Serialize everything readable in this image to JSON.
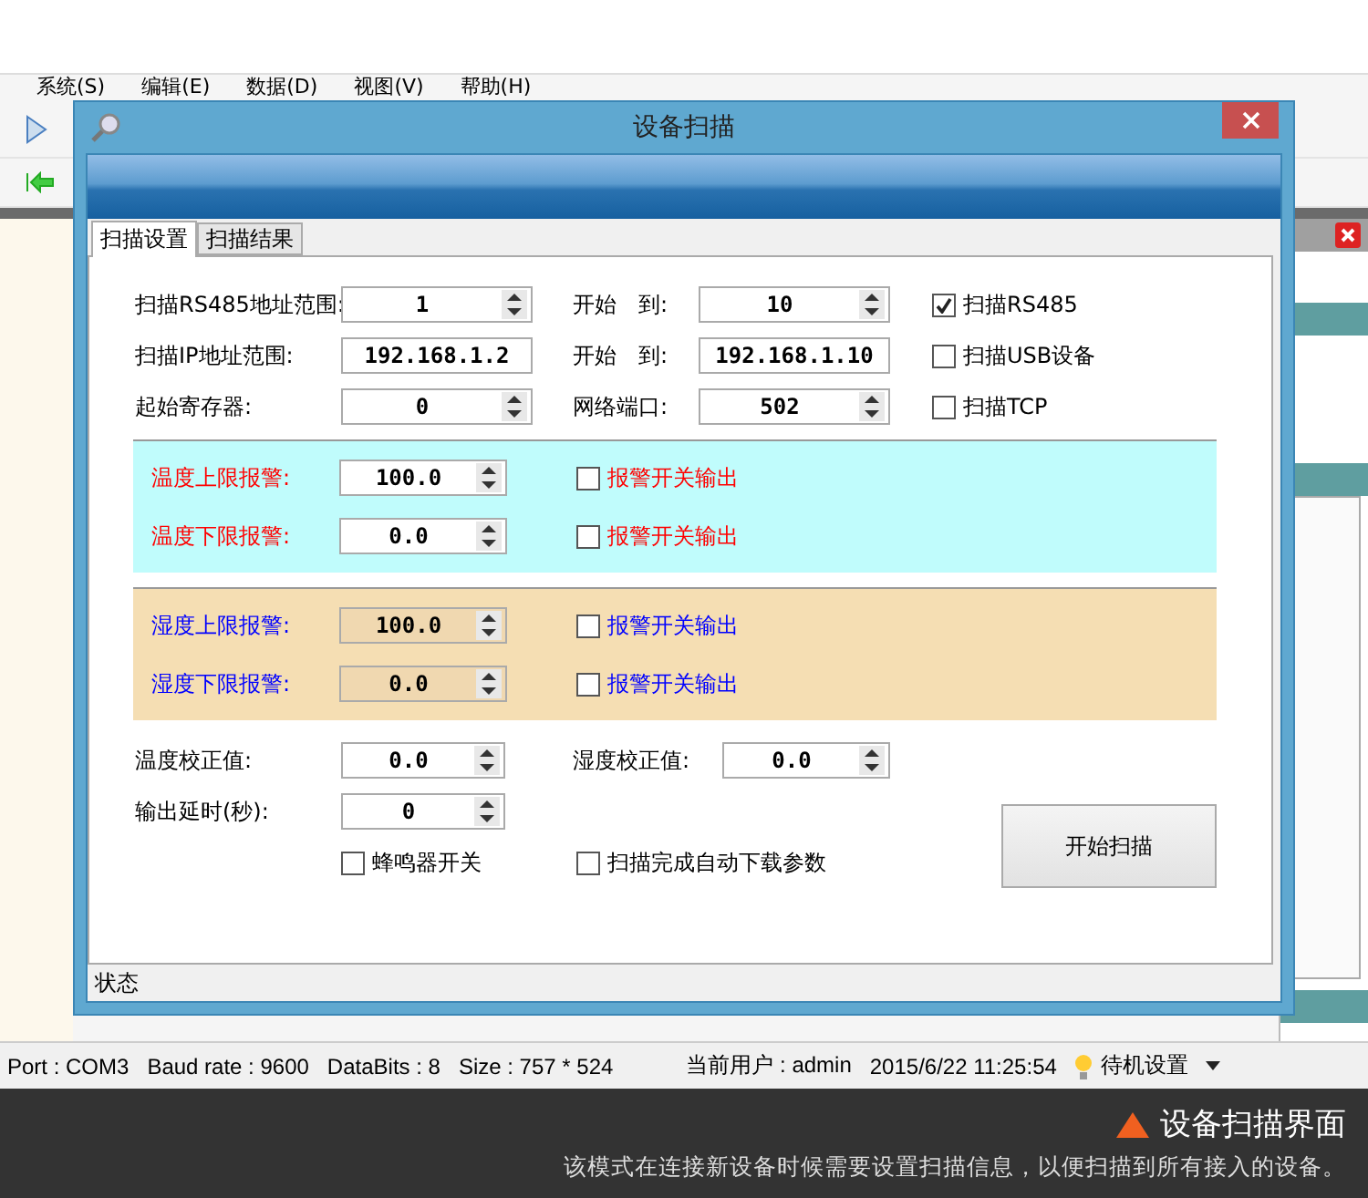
{
  "app": {
    "menu": [
      "系统(S)",
      "编辑(E)",
      "数据(D)",
      "视图(V)",
      "帮助(H)"
    ]
  },
  "dialog": {
    "title": "设备扫描",
    "tabs": [
      {
        "label": "扫描设置",
        "selected": true
      },
      {
        "label": "扫描结果",
        "selected": false
      }
    ],
    "scan_rows": [
      {
        "label": "扫描RS485地址范围:",
        "from": {
          "kind": "spin",
          "value": "1"
        },
        "to_label": "开始　到:",
        "to": {
          "kind": "spin",
          "value": "10"
        },
        "option": {
          "label": "扫描RS485",
          "checked": true
        }
      },
      {
        "label": "扫描IP地址范围:",
        "from": {
          "kind": "text",
          "value": "192.168.1.2"
        },
        "to_label": "开始　到:",
        "to": {
          "kind": "text",
          "value": "192.168.1.10"
        },
        "option": {
          "label": "扫描USB设备",
          "checked": false
        }
      },
      {
        "label": "起始寄存器:",
        "from": {
          "kind": "spin",
          "value": "0"
        },
        "to_label": "网络端口:",
        "to": {
          "kind": "spin",
          "value": "502"
        },
        "option": {
          "label": "扫描TCP",
          "checked": false
        }
      }
    ],
    "alarm_panels": [
      {
        "kind": "temperature",
        "rows": [
          {
            "label": "温度上限报警:",
            "value": "100.0",
            "option": {
              "label": "报警开关输出",
              "checked": false
            }
          },
          {
            "label": "温度下限报警:",
            "value": "0.0",
            "option": {
              "label": "报警开关输出",
              "checked": false
            }
          }
        ]
      },
      {
        "kind": "humidity",
        "rows": [
          {
            "label": "湿度上限报警:",
            "value": "100.0",
            "option": {
              "label": "报警开关输出",
              "checked": false
            }
          },
          {
            "label": "湿度下限报警:",
            "value": "0.0",
            "option": {
              "label": "报警开关输出",
              "checked": false
            }
          }
        ]
      }
    ],
    "calibration": [
      {
        "label": "温度校正值:",
        "value": "0.0"
      },
      {
        "label": "湿度校正值:",
        "value": "0.0"
      }
    ],
    "delay": {
      "label": "输出延时(秒):",
      "value": "0"
    },
    "options": [
      {
        "label": "蜂鸣器开关",
        "checked": false
      },
      {
        "label": "扫描完成自动下载参数",
        "checked": false
      }
    ],
    "start_button": "开始扫描",
    "status": "状态"
  },
  "status_bar": {
    "items": [
      "Port : COM3",
      "Baud rate  : 9600",
      "DataBits : 8",
      "Size : 757 * 524",
      "当前用户 : admin",
      "2015/6/22 11:25:54"
    ],
    "mode": "待机设置"
  },
  "caption": {
    "title": "设备扫描界面",
    "description": "该模式在连接新设备时候需要设置扫描信息，以便扫描到所有接入的设备。"
  }
}
